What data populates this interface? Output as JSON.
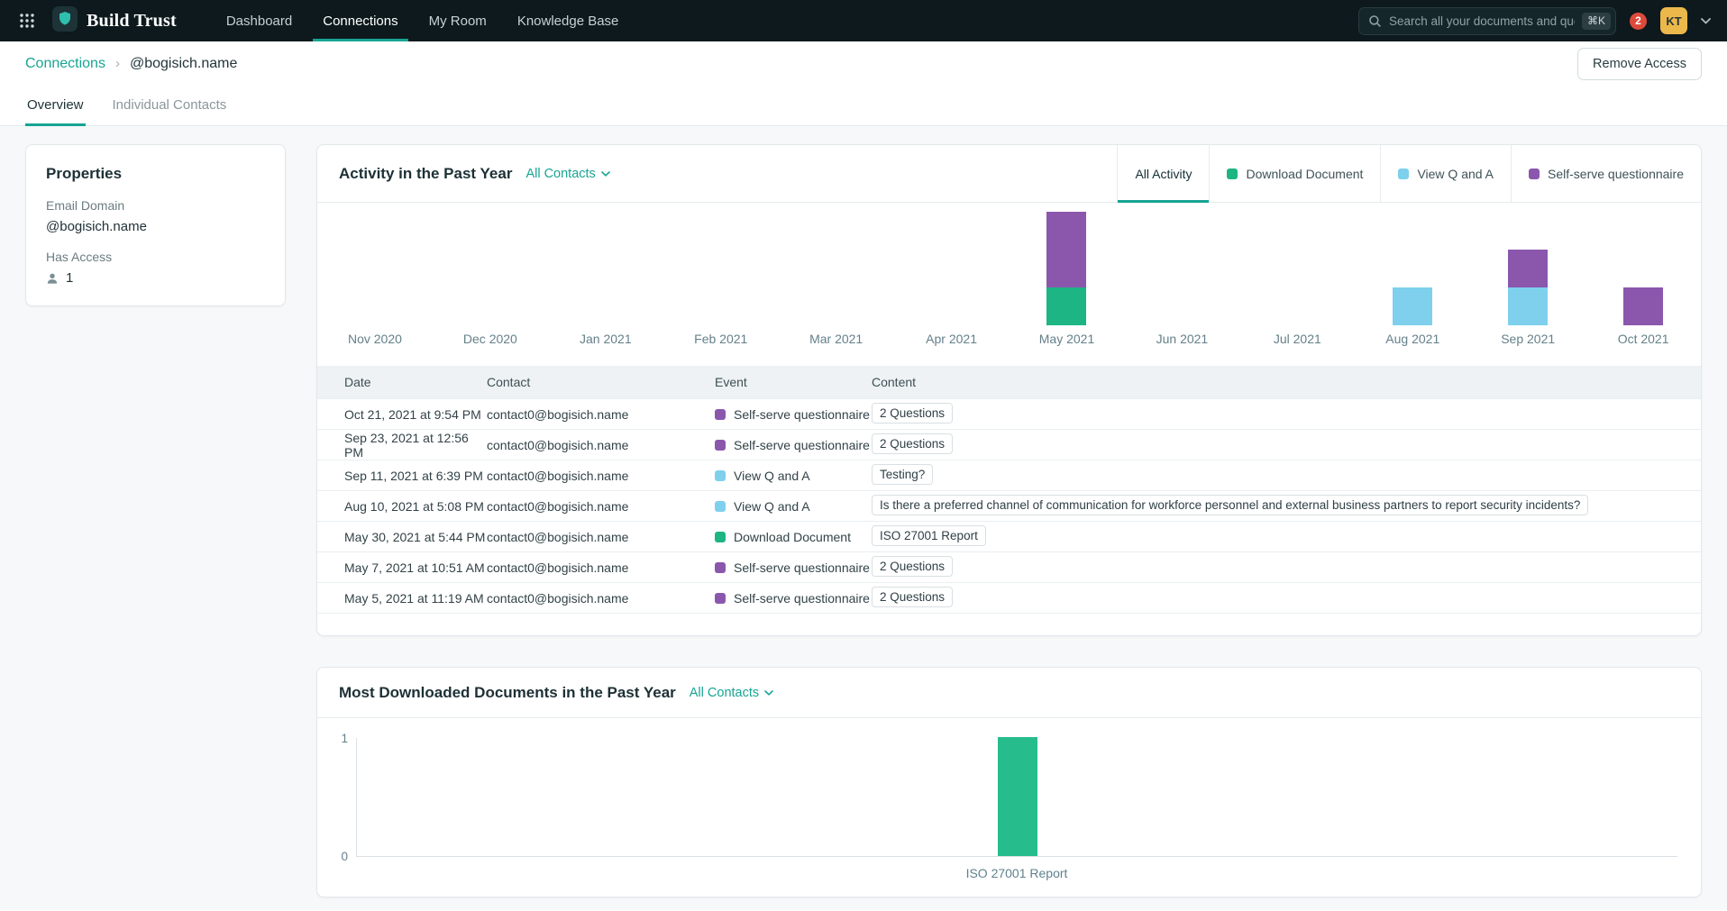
{
  "colors": {
    "accent": "#17a493",
    "download": "#1db583",
    "download_bar": "#27bc8b",
    "view": "#7ed0ed",
    "selfserve": "#8a57ad"
  },
  "nav": {
    "brand": "Build Trust",
    "items": [
      {
        "label": "Dashboard",
        "active": false
      },
      {
        "label": "Connections",
        "active": true
      },
      {
        "label": "My Room",
        "active": false
      },
      {
        "label": "Knowledge Base",
        "active": false
      }
    ],
    "search_placeholder": "Search all your documents and questions",
    "search_shortcut": "⌘K",
    "notification_count": "2",
    "avatar_initials": "KT"
  },
  "breadcrumb": {
    "parent": "Connections",
    "separator": "›",
    "current": "@bogisich.name"
  },
  "actions": {
    "remove_access": "Remove Access"
  },
  "tabs": [
    {
      "label": "Overview",
      "active": true
    },
    {
      "label": "Individual Contacts",
      "active": false
    }
  ],
  "properties": {
    "title": "Properties",
    "fields": [
      {
        "label": "Email Domain",
        "value": "@bogisich.name"
      },
      {
        "label": "Has Access",
        "value": "1",
        "icon": "person-icon"
      }
    ]
  },
  "activity": {
    "title": "Activity in the Past Year",
    "filter_label": "All Contacts",
    "legend_tabs": [
      {
        "label": "All Activity",
        "active": true
      },
      {
        "label": "Download Document",
        "color_key": "download"
      },
      {
        "label": "View Q and A",
        "color_key": "view"
      },
      {
        "label": "Self-serve questionnaire",
        "color_key": "selfserve"
      }
    ]
  },
  "table": {
    "headers": [
      "Date",
      "Contact",
      "Event",
      "Content"
    ],
    "rows": [
      {
        "date": "Oct 21, 2021 at 9:54 PM",
        "contact": "contact0@bogisich.name",
        "event": "Self-serve questionnaire",
        "event_type": "selfserve",
        "content": "2 Questions"
      },
      {
        "date": "Sep 23, 2021 at 12:56 PM",
        "contact": "contact0@bogisich.name",
        "event": "Self-serve questionnaire",
        "event_type": "selfserve",
        "content": "2 Questions"
      },
      {
        "date": "Sep 11, 2021 at 6:39 PM",
        "contact": "contact0@bogisich.name",
        "event": "View Q and A",
        "event_type": "view",
        "content": "Testing?"
      },
      {
        "date": "Aug 10, 2021 at 5:08 PM",
        "contact": "contact0@bogisich.name",
        "event": "View Q and A",
        "event_type": "view",
        "content": "Is there a preferred channel of communication for workforce personnel and external business partners to report security incidents?"
      },
      {
        "date": "May 30, 2021 at 5:44 PM",
        "contact": "contact0@bogisich.name",
        "event": "Download Document",
        "event_type": "download",
        "content": "ISO 27001 Report"
      },
      {
        "date": "May 7, 2021 at 10:51 AM",
        "contact": "contact0@bogisich.name",
        "event": "Self-serve questionnaire",
        "event_type": "selfserve",
        "content": "2 Questions"
      },
      {
        "date": "May 5, 2021 at 11:19 AM",
        "contact": "contact0@bogisich.name",
        "event": "Self-serve questionnaire",
        "event_type": "selfserve",
        "content": "2 Questions"
      }
    ]
  },
  "downloads": {
    "title": "Most Downloaded Documents in the Past Year",
    "filter_label": "All Contacts"
  },
  "chart_data": [
    {
      "id": "activity",
      "type": "bar",
      "stacked": true,
      "title": "Activity in the Past Year",
      "categories": [
        "Nov 2020",
        "Dec 2020",
        "Jan 2021",
        "Feb 2021",
        "Mar 2021",
        "Apr 2021",
        "May 2021",
        "Jun 2021",
        "Jul 2021",
        "Aug 2021",
        "Sep 2021",
        "Oct 2021"
      ],
      "series": [
        {
          "name": "Download Document",
          "color": "#1db583",
          "values": [
            0,
            0,
            0,
            0,
            0,
            0,
            1,
            0,
            0,
            0,
            0,
            0
          ]
        },
        {
          "name": "View Q and A",
          "color": "#7ed0ed",
          "values": [
            0,
            0,
            0,
            0,
            0,
            0,
            0,
            0,
            0,
            1,
            1,
            0
          ]
        },
        {
          "name": "Self-serve questionnaire",
          "color": "#8a57ad",
          "values": [
            0,
            0,
            0,
            0,
            0,
            0,
            2,
            0,
            0,
            0,
            1,
            1
          ]
        }
      ],
      "legend_position": "top-right",
      "grid": false
    },
    {
      "id": "downloads",
      "type": "bar",
      "title": "Most Downloaded Documents in the Past Year",
      "categories": [
        "ISO 27001 Report"
      ],
      "values": [
        1
      ],
      "yticks": [
        "1",
        "0"
      ],
      "ylim": [
        0,
        1
      ],
      "color": "#27bc8b",
      "grid": false
    }
  ]
}
